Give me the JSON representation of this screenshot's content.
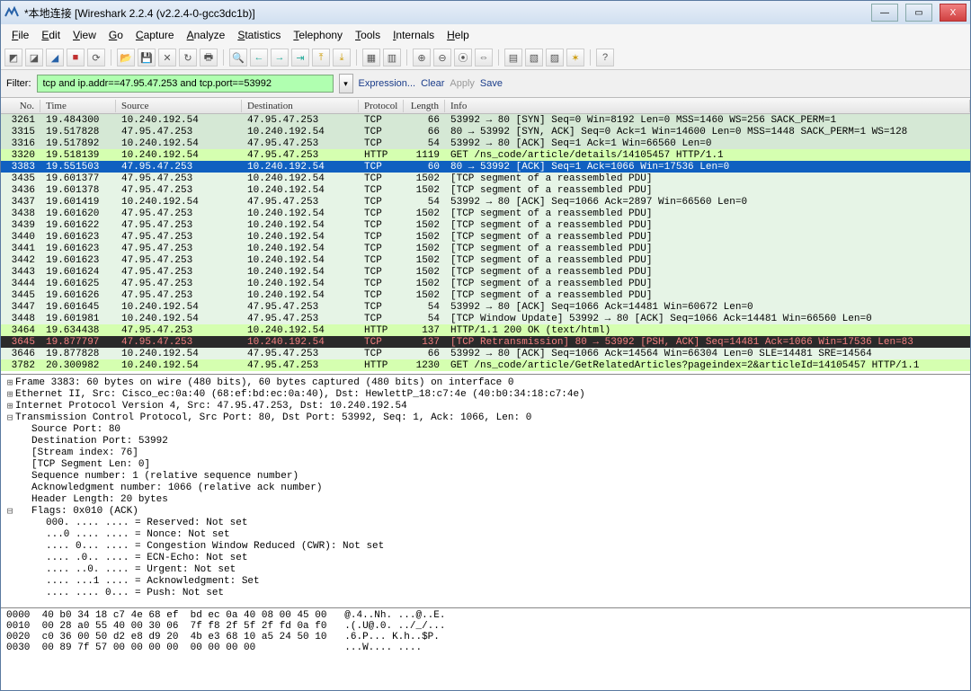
{
  "titlebar": {
    "title": "*本地连接 [Wireshark 2.2.4 (v2.2.4-0-gcc3dc1b)]",
    "min": "—",
    "max": "▭",
    "close": "X"
  },
  "menus": [
    "File",
    "Edit",
    "View",
    "Go",
    "Capture",
    "Analyze",
    "Statistics",
    "Telephony",
    "Tools",
    "Internals",
    "Help"
  ],
  "filter": {
    "label": "Filter:",
    "value": "tcp and ip.addr==47.95.47.253 and tcp.port==53992",
    "expression": "Expression...",
    "clear": "Clear",
    "apply": "Apply",
    "save": "Save"
  },
  "columns": {
    "no": "No.",
    "time": "Time",
    "source": "Source",
    "destination": "Destination",
    "protocol": "Protocol",
    "length": "Length",
    "info": "Info"
  },
  "packets": [
    {
      "no": "3261",
      "time": "19.484300",
      "src": "10.240.192.54",
      "dst": "47.95.47.253",
      "proto": "TCP",
      "len": "66",
      "info": "53992 → 80 [SYN] Seq=0 Win=8192 Len=0 MSS=1460 WS=256 SACK_PERM=1",
      "style": "bg-syn"
    },
    {
      "no": "3315",
      "time": "19.517828",
      "src": "47.95.47.253",
      "dst": "10.240.192.54",
      "proto": "TCP",
      "len": "66",
      "info": "80 → 53992 [SYN, ACK] Seq=0 Ack=1 Win=14600 Len=0 MSS=1448 SACK_PERM=1 WS=128",
      "style": "bg-syn"
    },
    {
      "no": "3316",
      "time": "19.517892",
      "src": "10.240.192.54",
      "dst": "47.95.47.253",
      "proto": "TCP",
      "len": "54",
      "info": "53992 → 80 [ACK] Seq=1 Ack=1 Win=66560 Len=0",
      "style": "bg-syn"
    },
    {
      "no": "3320",
      "time": "19.518139",
      "src": "10.240.192.54",
      "dst": "47.95.47.253",
      "proto": "HTTP",
      "len": "1119",
      "info": "GET /ns_code/article/details/14105457 HTTP/1.1",
      "style": "bg-http"
    },
    {
      "no": "3383",
      "time": "19.551503",
      "src": "47.95.47.253",
      "dst": "10.240.192.54",
      "proto": "TCP",
      "len": "60",
      "info": "80 → 53992 [ACK] Seq=1 Ack=1066 Win=17536 Len=0",
      "style": "bg-sel"
    },
    {
      "no": "3435",
      "time": "19.601377",
      "src": "47.95.47.253",
      "dst": "10.240.192.54",
      "proto": "TCP",
      "len": "1502",
      "info": "[TCP segment of a reassembled PDU]",
      "style": "bg-seg"
    },
    {
      "no": "3436",
      "time": "19.601378",
      "src": "47.95.47.253",
      "dst": "10.240.192.54",
      "proto": "TCP",
      "len": "1502",
      "info": "[TCP segment of a reassembled PDU]",
      "style": "bg-seg"
    },
    {
      "no": "3437",
      "time": "19.601419",
      "src": "10.240.192.54",
      "dst": "47.95.47.253",
      "proto": "TCP",
      "len": "54",
      "info": "53992 → 80 [ACK] Seq=1066 Ack=2897 Win=66560 Len=0",
      "style": "bg-seg"
    },
    {
      "no": "3438",
      "time": "19.601620",
      "src": "47.95.47.253",
      "dst": "10.240.192.54",
      "proto": "TCP",
      "len": "1502",
      "info": "[TCP segment of a reassembled PDU]",
      "style": "bg-seg"
    },
    {
      "no": "3439",
      "time": "19.601622",
      "src": "47.95.47.253",
      "dst": "10.240.192.54",
      "proto": "TCP",
      "len": "1502",
      "info": "[TCP segment of a reassembled PDU]",
      "style": "bg-seg"
    },
    {
      "no": "3440",
      "time": "19.601623",
      "src": "47.95.47.253",
      "dst": "10.240.192.54",
      "proto": "TCP",
      "len": "1502",
      "info": "[TCP segment of a reassembled PDU]",
      "style": "bg-seg"
    },
    {
      "no": "3441",
      "time": "19.601623",
      "src": "47.95.47.253",
      "dst": "10.240.192.54",
      "proto": "TCP",
      "len": "1502",
      "info": "[TCP segment of a reassembled PDU]",
      "style": "bg-seg"
    },
    {
      "no": "3442",
      "time": "19.601623",
      "src": "47.95.47.253",
      "dst": "10.240.192.54",
      "proto": "TCP",
      "len": "1502",
      "info": "[TCP segment of a reassembled PDU]",
      "style": "bg-seg"
    },
    {
      "no": "3443",
      "time": "19.601624",
      "src": "47.95.47.253",
      "dst": "10.240.192.54",
      "proto": "TCP",
      "len": "1502",
      "info": "[TCP segment of a reassembled PDU]",
      "style": "bg-seg"
    },
    {
      "no": "3444",
      "time": "19.601625",
      "src": "47.95.47.253",
      "dst": "10.240.192.54",
      "proto": "TCP",
      "len": "1502",
      "info": "[TCP segment of a reassembled PDU]",
      "style": "bg-seg"
    },
    {
      "no": "3445",
      "time": "19.601626",
      "src": "47.95.47.253",
      "dst": "10.240.192.54",
      "proto": "TCP",
      "len": "1502",
      "info": "[TCP segment of a reassembled PDU]",
      "style": "bg-seg"
    },
    {
      "no": "3447",
      "time": "19.601645",
      "src": "10.240.192.54",
      "dst": "47.95.47.253",
      "proto": "TCP",
      "len": "54",
      "info": "53992 → 80 [ACK] Seq=1066 Ack=14481 Win=60672 Len=0",
      "style": "bg-seg"
    },
    {
      "no": "3448",
      "time": "19.601981",
      "src": "10.240.192.54",
      "dst": "47.95.47.253",
      "proto": "TCP",
      "len": "54",
      "info": "[TCP Window Update] 53992 → 80 [ACK] Seq=1066 Ack=14481 Win=66560 Len=0",
      "style": "bg-seg"
    },
    {
      "no": "3464",
      "time": "19.634438",
      "src": "47.95.47.253",
      "dst": "10.240.192.54",
      "proto": "HTTP",
      "len": "137",
      "info": "HTTP/1.1 200 OK  (text/html)",
      "style": "bg-http"
    },
    {
      "no": "3645",
      "time": "19.877797",
      "src": "47.95.47.253",
      "dst": "10.240.192.54",
      "proto": "TCP",
      "len": "137",
      "info": "[TCP Retransmission] 80 → 53992 [PSH, ACK] Seq=14481 Ack=1066 Win=17536 Len=83",
      "style": "bg-retr"
    },
    {
      "no": "3646",
      "time": "19.877828",
      "src": "10.240.192.54",
      "dst": "47.95.47.253",
      "proto": "TCP",
      "len": "66",
      "info": "53992 → 80 [ACK] Seq=1066 Ack=14564 Win=66304 Len=0 SLE=14481 SRE=14564",
      "style": "bg-seg"
    },
    {
      "no": "3782",
      "time": "20.300982",
      "src": "10.240.192.54",
      "dst": "47.95.47.253",
      "proto": "HTTP",
      "len": "1230",
      "info": "GET /ns_code/article/GetRelatedArticles?pageindex=2&articleId=14105457 HTTP/1.1",
      "style": "bg-http"
    }
  ],
  "details": [
    {
      "tgl": "⊞",
      "ind": "ind0",
      "text": "Frame 3383: 60 bytes on wire (480 bits), 60 bytes captured (480 bits) on interface 0"
    },
    {
      "tgl": "⊞",
      "ind": "ind0",
      "text": "Ethernet II, Src: Cisco_ec:0a:40 (68:ef:bd:ec:0a:40), Dst: HewlettP_18:c7:4e (40:b0:34:18:c7:4e)"
    },
    {
      "tgl": "⊞",
      "ind": "ind0",
      "text": "Internet Protocol Version 4, Src: 47.95.47.253, Dst: 10.240.192.54"
    },
    {
      "tgl": "⊟",
      "ind": "ind0",
      "text": "Transmission Control Protocol, Src Port: 80, Dst Port: 53992, Seq: 1, Ack: 1066, Len: 0"
    },
    {
      "tgl": "",
      "ind": "ind1",
      "text": "Source Port: 80"
    },
    {
      "tgl": "",
      "ind": "ind1",
      "text": "Destination Port: 53992"
    },
    {
      "tgl": "",
      "ind": "ind1",
      "text": "[Stream index: 76]"
    },
    {
      "tgl": "",
      "ind": "ind1",
      "text": "[TCP Segment Len: 0]"
    },
    {
      "tgl": "",
      "ind": "ind1",
      "text": "Sequence number: 1    (relative sequence number)"
    },
    {
      "tgl": "",
      "ind": "ind1",
      "text": "Acknowledgment number: 1066    (relative ack number)"
    },
    {
      "tgl": "",
      "ind": "ind1",
      "text": "Header Length: 20 bytes"
    },
    {
      "tgl": "⊟",
      "ind": "ind1",
      "text": "Flags: 0x010 (ACK)"
    },
    {
      "tgl": "",
      "ind": "ind2",
      "text": "000. .... .... = Reserved: Not set"
    },
    {
      "tgl": "",
      "ind": "ind2",
      "text": "...0 .... .... = Nonce: Not set"
    },
    {
      "tgl": "",
      "ind": "ind2",
      "text": ".... 0... .... = Congestion Window Reduced (CWR): Not set"
    },
    {
      "tgl": "",
      "ind": "ind2",
      "text": ".... .0.. .... = ECN-Echo: Not set"
    },
    {
      "tgl": "",
      "ind": "ind2",
      "text": ".... ..0. .... = Urgent: Not set"
    },
    {
      "tgl": "",
      "ind": "ind2",
      "text": ".... ...1 .... = Acknowledgment: Set"
    },
    {
      "tgl": "",
      "ind": "ind2",
      "text": ".... .... 0... = Push: Not set"
    }
  ],
  "hex": [
    "0000  40 b0 34 18 c7 4e 68 ef  bd ec 0a 40 08 00 45 00   @.4..Nh. ...@..E.",
    "0010  00 28 a0 55 40 00 30 06  7f f8 2f 5f 2f fd 0a f0   .(.U@.0. ../_/...",
    "0020  c0 36 00 50 d2 e8 d9 20  4b e3 68 10 a5 24 50 10   .6.P... K.h..$P.",
    "0030  00 89 7f 57 00 00 00 00  00 00 00 00               ...W.... ...."
  ]
}
